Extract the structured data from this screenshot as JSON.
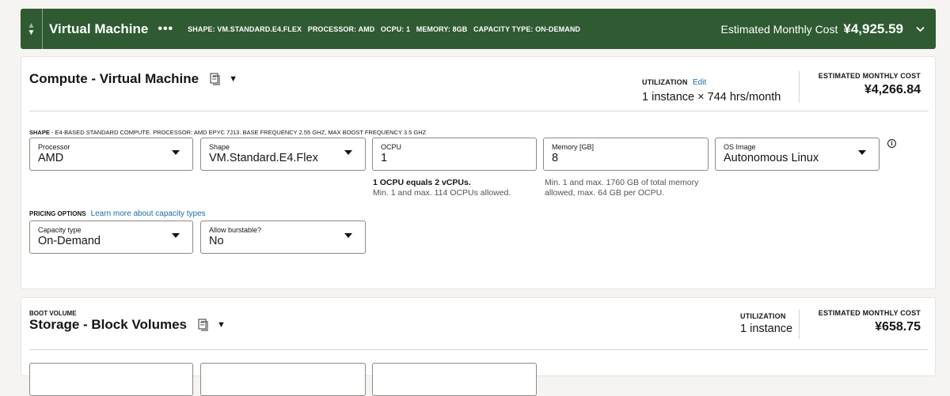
{
  "header": {
    "title": "Virtual Machine",
    "more": "•••",
    "summary": [
      "SHAPE: VM.STANDARD.E4.FLEX",
      "PROCESSOR: AMD",
      "OCPU: 1",
      "MEMORY: 8GB",
      "CAPACITY TYPE: ON-DEMAND"
    ],
    "cost_label": "Estimated Monthly Cost",
    "cost_value": "¥4,925.59"
  },
  "compute": {
    "title": "Compute - Virtual Machine",
    "utilization_label": "UTILIZATION",
    "utilization_edit": "Edit",
    "utilization_value": "1 instance  ×  744 hrs/month",
    "cost_label": "ESTIMATED MONTHLY COST",
    "cost_value": "¥4,266.84",
    "shape_label": "SHAPE",
    "shape_desc": " - E4-BASED STANDARD COMPUTE. PROCESSOR: AMD EPYC 7J13. BASE FREQUENCY 2.55 GHZ, MAX BOOST FREQUENCY 3.5 GHZ",
    "fields": {
      "processor": {
        "label": "Processor",
        "value": "AMD"
      },
      "shape": {
        "label": "Shape",
        "value": "VM.Standard.E4.Flex"
      },
      "ocpu": {
        "label": "OCPU",
        "value": "1"
      },
      "memory": {
        "label": "Memory [GB]",
        "value": "8"
      },
      "os_image": {
        "label": "OS Image",
        "value": "Autonomous Linux"
      }
    },
    "ocpu_help_bold": "1 OCPU equals 2 vCPUs.",
    "ocpu_help": "Min. 1 and max. 114 OCPUs allowed.",
    "memory_help_line1": "Min. 1 and max. 1760 GB of total memory",
    "memory_help_line2": "allowed, max. 64 GB per OCPU.",
    "pricing_label": "PRICING OPTIONS",
    "pricing_link": "Learn more about capacity types",
    "capacity_type": {
      "label": "Capacity type",
      "value": "On-Demand"
    },
    "burstable": {
      "label": "Allow burstable?",
      "value": "No"
    }
  },
  "storage": {
    "section_label": "BOOT VOLUME",
    "title": "Storage - Block Volumes",
    "utilization_label": "UTILIZATION",
    "utilization_value": "1 instance",
    "cost_label": "ESTIMATED MONTHLY COST",
    "cost_value": "¥658.75"
  },
  "icons": {
    "info": "i"
  }
}
